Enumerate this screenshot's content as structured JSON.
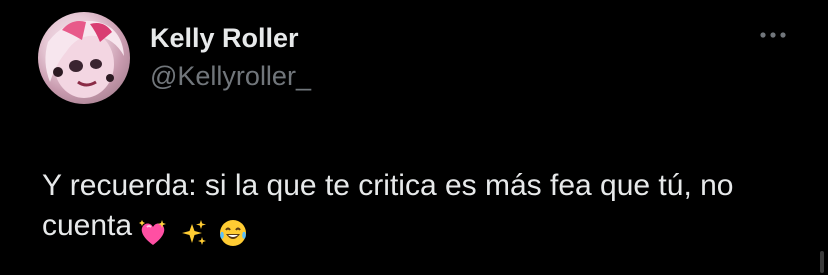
{
  "post": {
    "author": {
      "display_name": "Kelly Roller",
      "handle": "@Kellyroller_",
      "avatar_icon": "profile-photo"
    },
    "text": "Y recuerda: si la que te critica es más fea que tú, no cuenta",
    "emojis": [
      "💖",
      "✨",
      "😂"
    ],
    "more_icon": "ellipsis-icon"
  },
  "colors": {
    "background": "#000000",
    "name": "#e7e9ea",
    "handle": "#71767b",
    "body_text": "#e7e9ea"
  }
}
